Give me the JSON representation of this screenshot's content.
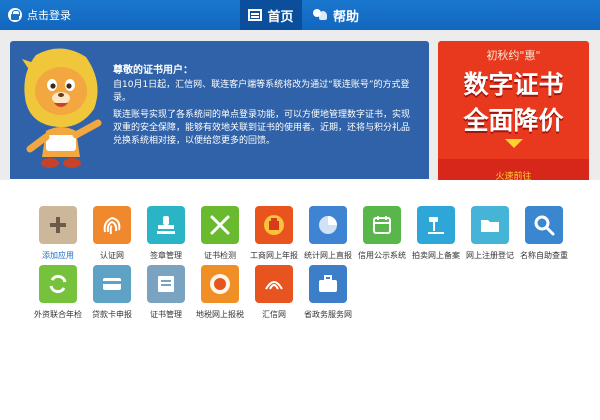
{
  "header": {
    "login_label": "点击登录",
    "tabs": [
      {
        "label": "首页",
        "active": true
      },
      {
        "label": "帮助",
        "active": false
      }
    ],
    "accent_color": "#1a6fc7"
  },
  "notice": {
    "title": "尊敬的证书用户：",
    "paragraph1": "自10月1日起，汇信网、联连客户端等系统将改为通过“联连账号”的方式登录。",
    "paragraph2": "联连账号实现了各系统间的单点登录功能，可以方便地管理数字证书，实现双重的安全保障，能够有效地关联到证书的使用者。近期，还将与积分礼品兑换系统相对接，以便给您更多的回馈。",
    "mascot": "lion-mascot-icon"
  },
  "promo": {
    "top_text": "初秋约\"惠\"",
    "line1": "数字证书",
    "line2": "全面降价",
    "cta": "火速前往"
  },
  "apps": [
    {
      "label": "添加应用",
      "icon": "plus-icon",
      "color": "#cdb79b",
      "accent": true
    },
    {
      "label": "认证网",
      "icon": "fingerprint-icon",
      "color": "#f0892e"
    },
    {
      "label": "签章管理",
      "icon": "stamp-icon",
      "color": "#2bb3c6"
    },
    {
      "label": "证书检测",
      "icon": "tools-icon",
      "color": "#6aba2f"
    },
    {
      "label": "工商网上年报",
      "icon": "emblem-icon",
      "color": "#e9541e"
    },
    {
      "label": "统计网上直报",
      "icon": "pie-chart-icon",
      "color": "#3f84d3"
    },
    {
      "label": "信用公示系统",
      "icon": "calendar-icon",
      "color": "#58b64b"
    },
    {
      "label": "拍卖网上备案",
      "icon": "gavel-icon",
      "color": "#2fa6d8"
    },
    {
      "label": "网上注册登记",
      "icon": "folder-icon",
      "color": "#45b4d6"
    },
    {
      "label": "名称自助查重",
      "icon": "magnifier-icon",
      "color": "#3a87cf"
    },
    {
      "label": "外资联合年检",
      "icon": "loop-icon",
      "color": "#76c23d"
    },
    {
      "label": "贷款卡申报",
      "icon": "card-icon",
      "color": "#5ea3c6"
    },
    {
      "label": "证书管理",
      "icon": "certificate-icon",
      "color": "#7aa3c2"
    },
    {
      "label": "地税网上报税",
      "icon": "emblem-icon",
      "color": "#f08f25"
    },
    {
      "label": "汇信网",
      "icon": "huixin-logo-icon",
      "color": "#e8541f"
    },
    {
      "label": "省政务服务网",
      "icon": "briefcase-icon",
      "color": "#3c7fc8"
    }
  ]
}
